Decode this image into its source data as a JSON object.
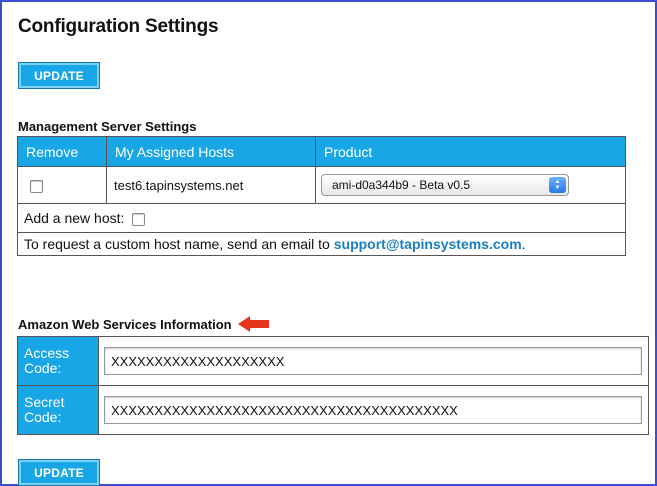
{
  "page": {
    "title": "Configuration Settings",
    "update_label": "UPDATE"
  },
  "management": {
    "section_title": "Management Server Settings",
    "columns": [
      "Remove",
      "My Assigned Hosts",
      "Product"
    ],
    "rows": [
      {
        "host": "test6.tapinsystems.net",
        "product": "ami-d0a344b9 - Beta v0.5"
      }
    ],
    "add_host_label": "Add a new host:",
    "request_text": "To request a custom host name, send an email to",
    "support_email": "support@tapinsystems.com",
    "request_suffix": "."
  },
  "aws": {
    "section_title": "Amazon Web Services Information",
    "access_label": "Access Code:",
    "access_value": "XXXXXXXXXXXXXXXXXXXX",
    "secret_label": "Secret Code:",
    "secret_value": "XXXXXXXXXXXXXXXXXXXXXXXXXXXXXXXXXXXXXXXX"
  },
  "icons": {
    "arrow": "red-left-arrow-icon",
    "select": "up-down-chevron-icon"
  },
  "colors": {
    "accent": "#19a6e6",
    "frame": "#3b4fd6",
    "link": "#1a7fc1",
    "annotation": "#e8361c"
  }
}
